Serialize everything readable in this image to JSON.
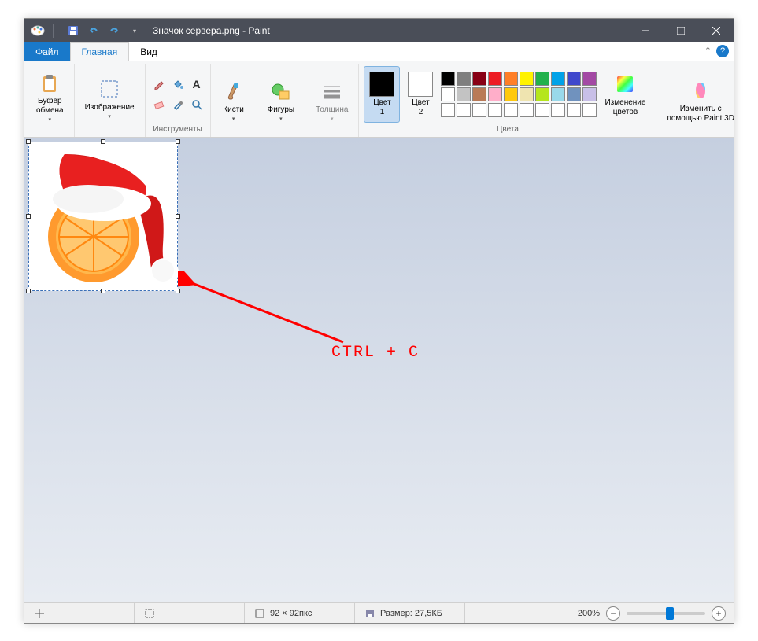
{
  "title": "Значок сервера.png - Paint",
  "tabs": {
    "file": "Файл",
    "home": "Главная",
    "view": "Вид"
  },
  "ribbon": {
    "clipboard": {
      "paste": "Буфер\nобмена",
      "label": ""
    },
    "image": {
      "select": "Изображение",
      "label": ""
    },
    "tools": {
      "label": "Инструменты"
    },
    "brushes": {
      "btn": "Кисти",
      "label": ""
    },
    "shapes": {
      "btn": "Фигуры",
      "label": ""
    },
    "size": {
      "btn": "Толщина",
      "label": ""
    },
    "colors": {
      "c1": "Цвет\n1",
      "c2": "Цвет\n2",
      "edit": "Изменение\nцветов",
      "label": "Цвета"
    },
    "paint3d": {
      "btn": "Изменить с\nпомощью Paint 3D"
    }
  },
  "palette": [
    "#000000",
    "#7f7f7f",
    "#880015",
    "#ed1c24",
    "#ff7f27",
    "#fff200",
    "#22b14c",
    "#00a2e8",
    "#3f48cc",
    "#a349a4",
    "#ffffff",
    "#c3c3c3",
    "#b97a57",
    "#ffaec9",
    "#ffc90e",
    "#efe4b0",
    "#b5e61d",
    "#99d9ea",
    "#7092be",
    "#c8bfe7",
    "#ffffff",
    "#ffffff",
    "#ffffff",
    "#ffffff",
    "#ffffff",
    "#ffffff",
    "#ffffff",
    "#ffffff",
    "#ffffff",
    "#ffffff"
  ],
  "annotation": "CTRL + C",
  "status": {
    "dimensions": "92 × 92пкс",
    "size": "Размер: 27,5КБ",
    "zoom": "200%"
  }
}
